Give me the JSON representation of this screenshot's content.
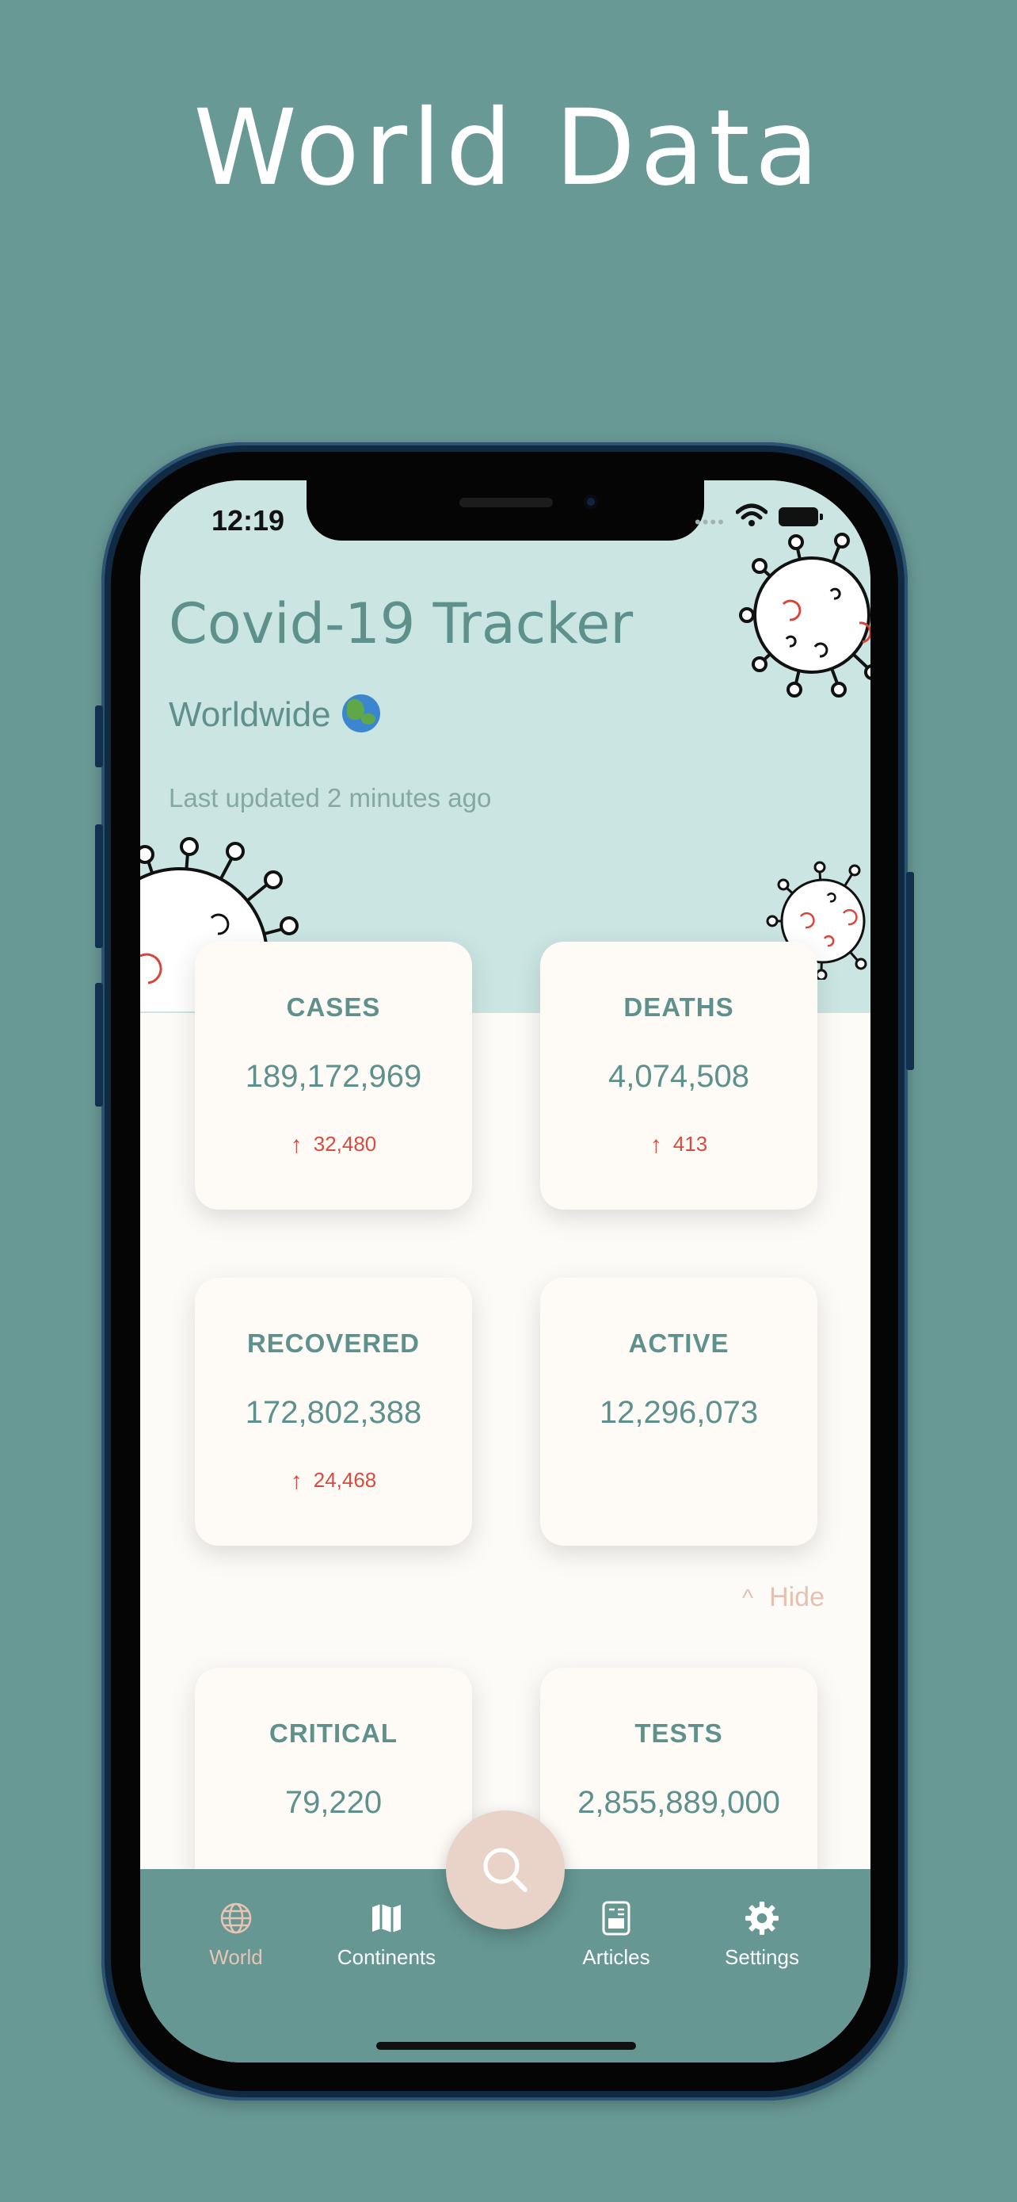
{
  "promo_title": "World Data",
  "status_bar": {
    "time": "12:19"
  },
  "header": {
    "title": "Covid-19 Tracker",
    "region": "Worldwide",
    "region_icon": "globe-emoji",
    "updated": "Last updated 2 minutes ago"
  },
  "stats": {
    "cases": {
      "label": "CASES",
      "value": "189,172,969",
      "delta": "32,480"
    },
    "deaths": {
      "label": "DEATHS",
      "value": "4,074,508",
      "delta": "413"
    },
    "recovered": {
      "label": "RECOVERED",
      "value": "172,802,388",
      "delta": "24,468"
    },
    "active": {
      "label": "ACTIVE",
      "value": "12,296,073"
    },
    "critical": {
      "label": "CRITICAL",
      "value": "79,220"
    },
    "tests": {
      "label": "TESTS",
      "value": "2,855,889,000"
    }
  },
  "hide_label": "Hide",
  "tabs": [
    {
      "label": "World",
      "icon": "globe-icon",
      "active": true
    },
    {
      "label": "Continents",
      "icon": "map-icon",
      "active": false
    },
    {
      "label": "Articles",
      "icon": "article-icon",
      "active": false
    },
    {
      "label": "Settings",
      "icon": "gear-icon",
      "active": false
    }
  ],
  "fab_icon": "search-icon",
  "colors": {
    "background": "#699995",
    "header": "#cae5e2",
    "accent": "#5e918c",
    "delta": "#d84c3f",
    "active_tab": "#e8c4b3"
  }
}
